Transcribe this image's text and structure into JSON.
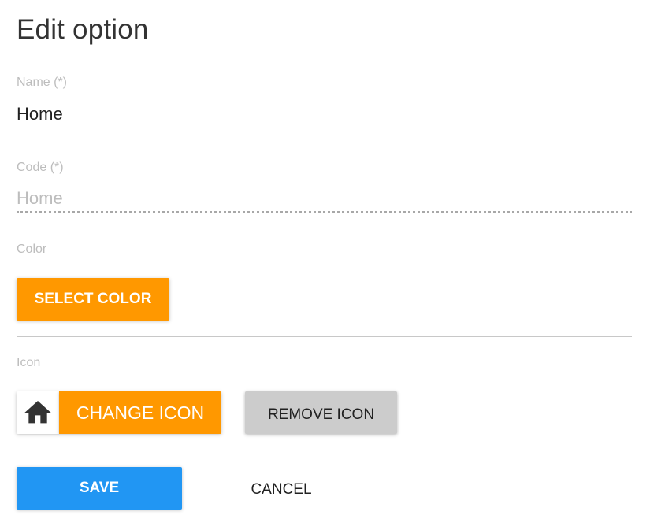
{
  "dialog": {
    "title": "Edit option"
  },
  "fields": {
    "name": {
      "label": "Name (*)",
      "value": "Home"
    },
    "code": {
      "label": "Code (*)",
      "value": "Home"
    },
    "color": {
      "label": "Color",
      "select_button": "SELECT COLOR",
      "current_color": "#ff9800"
    },
    "icon": {
      "label": "Icon",
      "current_icon": "home-icon",
      "change_button": "CHANGE ICON",
      "remove_button": "REMOVE ICON"
    }
  },
  "actions": {
    "save_label": "SAVE",
    "cancel_label": "CANCEL"
  },
  "colors": {
    "accent_orange": "#ff9800",
    "primary_blue": "#2196f3",
    "neutral_grey": "#cccccc"
  }
}
